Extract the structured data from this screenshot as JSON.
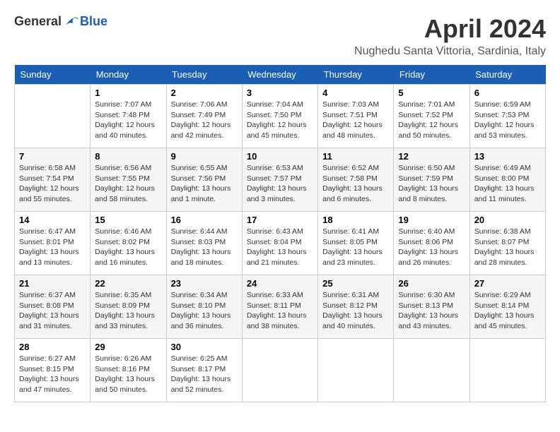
{
  "logo": {
    "general": "General",
    "blue": "Blue"
  },
  "title": "April 2024",
  "location": "Nughedu Santa Vittoria, Sardinia, Italy",
  "days_of_week": [
    "Sunday",
    "Monday",
    "Tuesday",
    "Wednesday",
    "Thursday",
    "Friday",
    "Saturday"
  ],
  "weeks": [
    [
      {
        "day": "",
        "info": ""
      },
      {
        "day": "1",
        "info": "Sunrise: 7:07 AM\nSunset: 7:48 PM\nDaylight: 12 hours\nand 40 minutes."
      },
      {
        "day": "2",
        "info": "Sunrise: 7:06 AM\nSunset: 7:49 PM\nDaylight: 12 hours\nand 42 minutes."
      },
      {
        "day": "3",
        "info": "Sunrise: 7:04 AM\nSunset: 7:50 PM\nDaylight: 12 hours\nand 45 minutes."
      },
      {
        "day": "4",
        "info": "Sunrise: 7:03 AM\nSunset: 7:51 PM\nDaylight: 12 hours\nand 48 minutes."
      },
      {
        "day": "5",
        "info": "Sunrise: 7:01 AM\nSunset: 7:52 PM\nDaylight: 12 hours\nand 50 minutes."
      },
      {
        "day": "6",
        "info": "Sunrise: 6:59 AM\nSunset: 7:53 PM\nDaylight: 12 hours\nand 53 minutes."
      }
    ],
    [
      {
        "day": "7",
        "info": "Sunrise: 6:58 AM\nSunset: 7:54 PM\nDaylight: 12 hours\nand 55 minutes."
      },
      {
        "day": "8",
        "info": "Sunrise: 6:56 AM\nSunset: 7:55 PM\nDaylight: 12 hours\nand 58 minutes."
      },
      {
        "day": "9",
        "info": "Sunrise: 6:55 AM\nSunset: 7:56 PM\nDaylight: 13 hours\nand 1 minute."
      },
      {
        "day": "10",
        "info": "Sunrise: 6:53 AM\nSunset: 7:57 PM\nDaylight: 13 hours\nand 3 minutes."
      },
      {
        "day": "11",
        "info": "Sunrise: 6:52 AM\nSunset: 7:58 PM\nDaylight: 13 hours\nand 6 minutes."
      },
      {
        "day": "12",
        "info": "Sunrise: 6:50 AM\nSunset: 7:59 PM\nDaylight: 13 hours\nand 8 minutes."
      },
      {
        "day": "13",
        "info": "Sunrise: 6:49 AM\nSunset: 8:00 PM\nDaylight: 13 hours\nand 11 minutes."
      }
    ],
    [
      {
        "day": "14",
        "info": "Sunrise: 6:47 AM\nSunset: 8:01 PM\nDaylight: 13 hours\nand 13 minutes."
      },
      {
        "day": "15",
        "info": "Sunrise: 6:46 AM\nSunset: 8:02 PM\nDaylight: 13 hours\nand 16 minutes."
      },
      {
        "day": "16",
        "info": "Sunrise: 6:44 AM\nSunset: 8:03 PM\nDaylight: 13 hours\nand 18 minutes."
      },
      {
        "day": "17",
        "info": "Sunrise: 6:43 AM\nSunset: 8:04 PM\nDaylight: 13 hours\nand 21 minutes."
      },
      {
        "day": "18",
        "info": "Sunrise: 6:41 AM\nSunset: 8:05 PM\nDaylight: 13 hours\nand 23 minutes."
      },
      {
        "day": "19",
        "info": "Sunrise: 6:40 AM\nSunset: 8:06 PM\nDaylight: 13 hours\nand 26 minutes."
      },
      {
        "day": "20",
        "info": "Sunrise: 6:38 AM\nSunset: 8:07 PM\nDaylight: 13 hours\nand 28 minutes."
      }
    ],
    [
      {
        "day": "21",
        "info": "Sunrise: 6:37 AM\nSunset: 8:08 PM\nDaylight: 13 hours\nand 31 minutes."
      },
      {
        "day": "22",
        "info": "Sunrise: 6:35 AM\nSunset: 8:09 PM\nDaylight: 13 hours\nand 33 minutes."
      },
      {
        "day": "23",
        "info": "Sunrise: 6:34 AM\nSunset: 8:10 PM\nDaylight: 13 hours\nand 36 minutes."
      },
      {
        "day": "24",
        "info": "Sunrise: 6:33 AM\nSunset: 8:11 PM\nDaylight: 13 hours\nand 38 minutes."
      },
      {
        "day": "25",
        "info": "Sunrise: 6:31 AM\nSunset: 8:12 PM\nDaylight: 13 hours\nand 40 minutes."
      },
      {
        "day": "26",
        "info": "Sunrise: 6:30 AM\nSunset: 8:13 PM\nDaylight: 13 hours\nand 43 minutes."
      },
      {
        "day": "27",
        "info": "Sunrise: 6:29 AM\nSunset: 8:14 PM\nDaylight: 13 hours\nand 45 minutes."
      }
    ],
    [
      {
        "day": "28",
        "info": "Sunrise: 6:27 AM\nSunset: 8:15 PM\nDaylight: 13 hours\nand 47 minutes."
      },
      {
        "day": "29",
        "info": "Sunrise: 6:26 AM\nSunset: 8:16 PM\nDaylight: 13 hours\nand 50 minutes."
      },
      {
        "day": "30",
        "info": "Sunrise: 6:25 AM\nSunset: 8:17 PM\nDaylight: 13 hours\nand 52 minutes."
      },
      {
        "day": "",
        "info": ""
      },
      {
        "day": "",
        "info": ""
      },
      {
        "day": "",
        "info": ""
      },
      {
        "day": "",
        "info": ""
      }
    ]
  ]
}
